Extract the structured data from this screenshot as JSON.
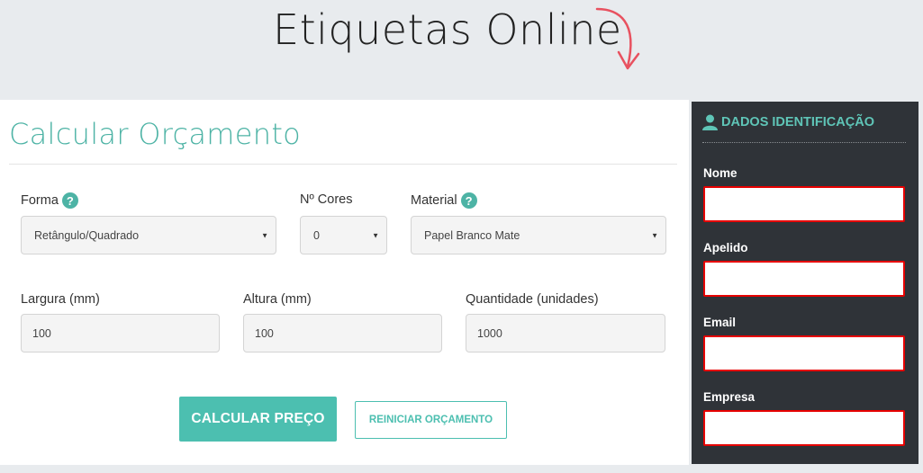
{
  "header": {
    "site_title": "Etiquetas Online"
  },
  "calculator": {
    "title": "Calcular Orçamento",
    "fields": {
      "forma": {
        "label": "Forma",
        "value": "Retângulo/Quadrado"
      },
      "cores": {
        "label": "Nº Cores",
        "value": "0"
      },
      "material": {
        "label": "Material",
        "value": "Papel Branco Mate"
      },
      "largura": {
        "label": "Largura (mm)",
        "value": "100"
      },
      "altura": {
        "label": "Altura (mm)",
        "value": "100"
      },
      "quantidade": {
        "label": "Quantidade (unidades)",
        "value": "1000"
      }
    },
    "help_glyph": "?",
    "buttons": {
      "calculate": "CALCULAR PREÇO",
      "reset": "REINICIAR ORÇAMENTO"
    }
  },
  "identification": {
    "title": "DADOS IDENTIFICAÇÃO",
    "icon": "user-icon",
    "fields": [
      {
        "label": "Nome",
        "value": ""
      },
      {
        "label": "Apelido",
        "value": ""
      },
      {
        "label": "Email",
        "value": ""
      },
      {
        "label": "Empresa",
        "value": ""
      }
    ]
  },
  "colors": {
    "accent": "#4cbfb0",
    "sidebar_bg": "#2f3338",
    "error_border": "#e60000",
    "arrow": "#e8515f"
  }
}
